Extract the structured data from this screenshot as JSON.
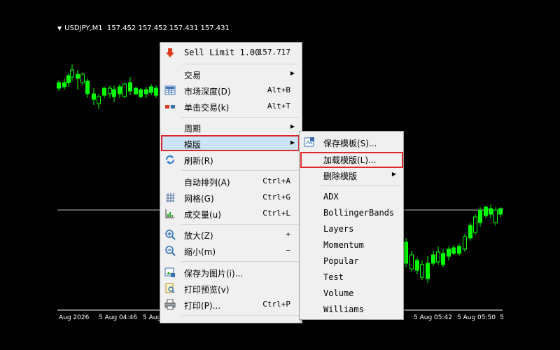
{
  "chart": {
    "symbol": "USDJPY,M1",
    "ohlc": "157.452 157.452 157.431 157.431",
    "bull_color": "#00ff00",
    "bear_color": "#00ff00",
    "background": "#000000",
    "x_labels": [
      "Aug 2026",
      "5 Aug 04:46",
      "5 Aug",
      "5 Aug 05:42",
      "5 Aug 05:50",
      "5"
    ]
  },
  "context_menu": {
    "sell_limit": {
      "label": "Sell Limit 1.00",
      "price": "157.717"
    },
    "trade": {
      "label": "交易"
    },
    "market_depth": {
      "label": "市场深度(D)",
      "shortcut": "Alt+B"
    },
    "one_click": {
      "label": "单击交易(k)",
      "shortcut": "Alt+T"
    },
    "period": {
      "label": "周期"
    },
    "template": {
      "label": "模版"
    },
    "refresh": {
      "label": "刷新(R)"
    },
    "autoscroll": {
      "label": "自动排列(A)",
      "shortcut": "Ctrl+A"
    },
    "grid": {
      "label": "网格(G)",
      "shortcut": "Ctrl+G"
    },
    "volumes": {
      "label": "成交量(u)",
      "shortcut": "Ctrl+L"
    },
    "zoom_in": {
      "label": "放大(Z)",
      "shortcut": "+"
    },
    "zoom_out": {
      "label": "缩小(m)",
      "shortcut": "−"
    },
    "save_picture": {
      "label": "保存为图片(i)..."
    },
    "print_preview": {
      "label": "打印预览(v)"
    },
    "print": {
      "label": "打印(P)...",
      "shortcut": "Ctrl+P"
    }
  },
  "template_submenu": {
    "save": {
      "label": "保存模板(S)..."
    },
    "load": {
      "label": "加载模版(L)..."
    },
    "remove": {
      "label": "删除模版"
    },
    "templates": [
      "ADX",
      "BollingerBands",
      "Layers",
      "Momentum",
      "Popular",
      "Test",
      "Volume",
      "Williams"
    ]
  },
  "colors": {
    "highlight": "#cce4f7",
    "annotation": "#e0282a",
    "menu_bg": "#f0f0f0"
  }
}
